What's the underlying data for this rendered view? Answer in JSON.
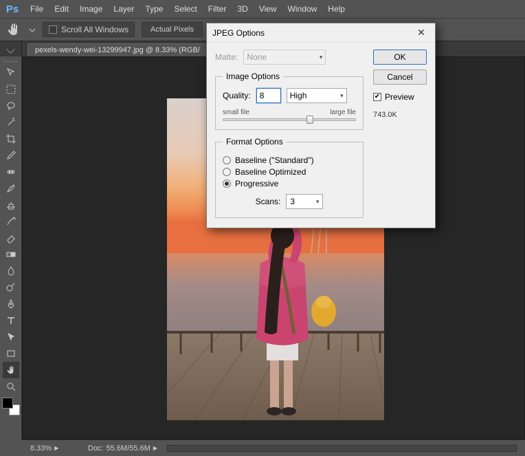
{
  "menubar": {
    "items": [
      "File",
      "Edit",
      "Image",
      "Layer",
      "Type",
      "Select",
      "Filter",
      "3D",
      "View",
      "Window",
      "Help"
    ]
  },
  "optionsbar": {
    "scroll_all_label": "Scroll All Windows",
    "actual_pixels_label": "Actual Pixels"
  },
  "tab": {
    "label": "pexels-wendy-wei-13299947.jpg @ 8.33% (RGB/"
  },
  "statusbar": {
    "zoom": "8.33%",
    "doc_label": "Doc:",
    "doc_value": "55.6M/55.6M"
  },
  "dialog": {
    "title": "JPEG Options",
    "matte_label": "Matte:",
    "matte_value": "None",
    "image_options_legend": "Image Options",
    "quality_label": "Quality:",
    "quality_value": "8",
    "quality_preset": "High",
    "slider_small": "small file",
    "slider_large": "large file",
    "format_options_legend": "Format Options",
    "radio_baseline_std": "Baseline (\"Standard\")",
    "radio_baseline_opt": "Baseline Optimized",
    "radio_progressive": "Progressive",
    "scans_label": "Scans:",
    "scans_value": "3",
    "ok_label": "OK",
    "cancel_label": "Cancel",
    "preview_label": "Preview",
    "filesize": "743.0K"
  }
}
